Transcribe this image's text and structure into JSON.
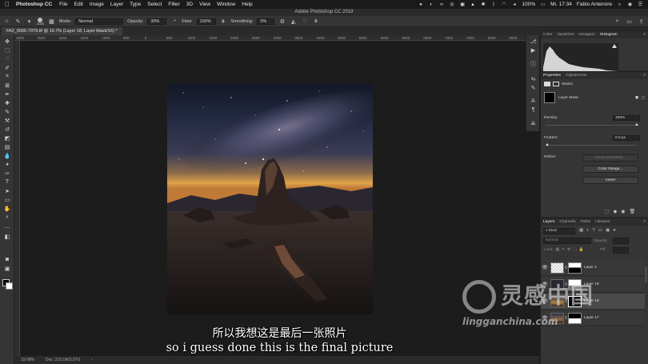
{
  "menubar": {
    "app_name": "Photoshop CC",
    "menus": [
      "File",
      "Edit",
      "Image",
      "Layer",
      "Type",
      "Select",
      "Filter",
      "3D",
      "View",
      "Window",
      "Help"
    ],
    "battery": "100%",
    "clock": "Mi. 17:34",
    "user": "Fabio Antenore"
  },
  "window_title": "Adobe Photoshop CC 2019",
  "options": {
    "brush_size": "2000",
    "mode_label": "Mode:",
    "mode_value": "Normal",
    "opacity_label": "Opacity:",
    "opacity_value": "30%",
    "flow_label": "Flow:",
    "flow_value": "100%",
    "smoothing_label": "Smoothing:",
    "smoothing_value": "0%"
  },
  "document": {
    "tab_label": "FA2_6566-7979.tif @ 19.7% (Layer 18, Layer Mask/16) *",
    "zoom": "19.68%",
    "doc_info": "Doc: 210.1M/3.97G"
  },
  "ruler_ticks": [
    "3000",
    "2500",
    "2000",
    "1500",
    "1000",
    "500",
    "0",
    "500",
    "1000",
    "1500",
    "2000",
    "2500",
    "3000",
    "3500",
    "4000",
    "4500",
    "5000",
    "5500",
    "6000",
    "6500",
    "7000",
    "7500",
    "8000",
    "8500",
    "9000"
  ],
  "panel_tabs": {
    "top": [
      "Color",
      "Swatches",
      "Navigator",
      "Histogram"
    ],
    "top_active": "Histogram",
    "props": [
      "Properties",
      "Adjustments"
    ],
    "props_active": "Properties",
    "layers": [
      "Layers",
      "Channels",
      "Paths",
      "Libraries"
    ],
    "layers_active": "Layers"
  },
  "properties": {
    "section": "Masks",
    "mask_name": "Layer Mask",
    "density_label": "Density:",
    "density_value": "100%",
    "feather_label": "Feather:",
    "feather_value": "0.0 px",
    "refine_label": "Refine:",
    "select_mask_btn": "Select and Mask...",
    "color_range_btn": "Color Range...",
    "invert_btn": "Invert"
  },
  "layers_panel": {
    "kind_filter": "Kind",
    "blend_mode": "Normal",
    "opacity_label": "Opacity:",
    "lock_label": "Lock:",
    "fill_label": "Fill:",
    "layers": [
      {
        "name": "Layer 1"
      },
      {
        "name": "Layer 19"
      },
      {
        "name": "Layer 18"
      },
      {
        "name": "Layer 17"
      }
    ]
  },
  "subtitles": {
    "zh": "所以我想这是最后一张照片",
    "en": "so i guess done this is the final picture"
  },
  "watermark": {
    "brand_cn": "灵感中国",
    "url": "lingganchina.com"
  },
  "colors": {
    "panel_bg": "#353535",
    "canvas_bg": "#1c1c1c",
    "accent_highlight": "#ffffff"
  }
}
